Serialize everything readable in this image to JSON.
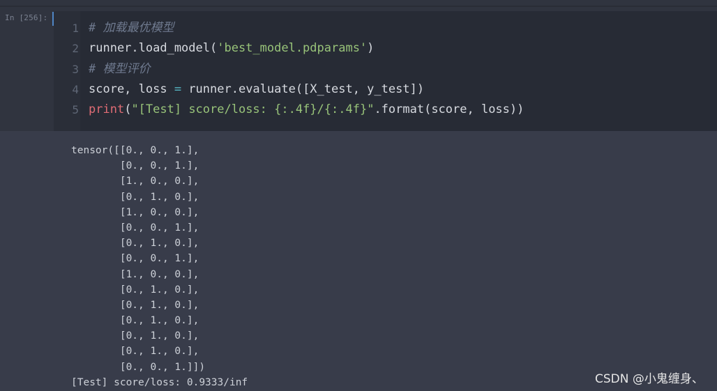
{
  "cell": {
    "prompt": "In [256]:",
    "code_lines": [
      {
        "num": "1",
        "parts": [
          {
            "t": "# 加载最优模型",
            "c": "cm"
          }
        ]
      },
      {
        "num": "2",
        "parts": [
          {
            "t": "runner.load_model(",
            "c": ""
          },
          {
            "t": "'best_model.pdparams'",
            "c": "st"
          },
          {
            "t": ")",
            "c": ""
          }
        ]
      },
      {
        "num": "3",
        "parts": [
          {
            "t": "# 模型评价",
            "c": "cm"
          }
        ]
      },
      {
        "num": "4",
        "parts": [
          {
            "t": "score, loss ",
            "c": ""
          },
          {
            "t": "=",
            "c": "op"
          },
          {
            "t": " runner.evaluate([X_test, y_test])",
            "c": ""
          }
        ]
      },
      {
        "num": "5",
        "parts": [
          {
            "t": "print",
            "c": "kw"
          },
          {
            "t": "(",
            "c": ""
          },
          {
            "t": "\"[Test] score/loss: {:.4f}/{:.4f}\"",
            "c": "st"
          },
          {
            "t": ".format(score, loss))",
            "c": ""
          }
        ]
      }
    ]
  },
  "output": {
    "lines": [
      "tensor([[0., 0., 1.],",
      "        [0., 0., 1.],",
      "        [1., 0., 0.],",
      "        [0., 1., 0.],",
      "        [1., 0., 0.],",
      "        [0., 0., 1.],",
      "        [0., 1., 0.],",
      "        [0., 0., 1.],",
      "        [1., 0., 0.],",
      "        [0., 1., 0.],",
      "        [0., 1., 0.],",
      "        [0., 1., 0.],",
      "        [0., 1., 0.],",
      "        [0., 1., 0.],",
      "        [0., 0., 1.]])",
      "[Test] score/loss: 0.9333/inf"
    ]
  },
  "watermark": "CSDN @小鬼缠身、"
}
